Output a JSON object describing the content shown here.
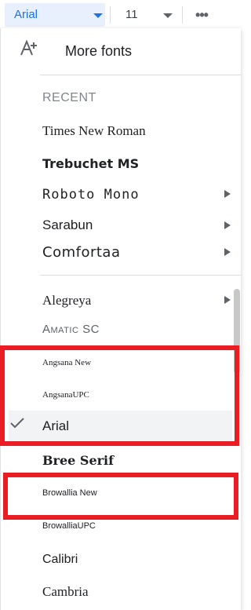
{
  "toolbar": {
    "font_value": "Arial",
    "size_value": "11",
    "more_label": "•••"
  },
  "menu": {
    "more_fonts_label": "More fonts",
    "recent_header": "RECENT",
    "recent": [
      {
        "label": "Times New Roman",
        "has_submenu": false
      },
      {
        "label": "Trebuchet MS",
        "has_submenu": false
      },
      {
        "label": "Roboto Mono",
        "has_submenu": true
      },
      {
        "label": "Sarabun",
        "has_submenu": true
      },
      {
        "label": "Comfortaa",
        "has_submenu": true
      }
    ],
    "fonts": [
      {
        "label": "Alegreya",
        "has_submenu": true
      },
      {
        "label": "Amatic SC",
        "has_submenu": false
      },
      {
        "label": "Angsana New",
        "has_submenu": false
      },
      {
        "label": "AngsanaUPC",
        "has_submenu": false
      },
      {
        "label": "Arial",
        "has_submenu": false,
        "selected": true
      },
      {
        "label": "Bree Serif",
        "has_submenu": false
      },
      {
        "label": "Browallia New",
        "has_submenu": false
      },
      {
        "label": "BrowalliaUPC",
        "has_submenu": false
      },
      {
        "label": "Calibri",
        "has_submenu": false
      },
      {
        "label": "Cambria",
        "has_submenu": false
      }
    ]
  },
  "icons": {
    "add_font": "add-font-icon",
    "check": "check-icon",
    "submenu": "submenu-arrow-icon"
  },
  "colors": {
    "accent": "#1a73e8",
    "highlight_box": "#ea1c24"
  }
}
